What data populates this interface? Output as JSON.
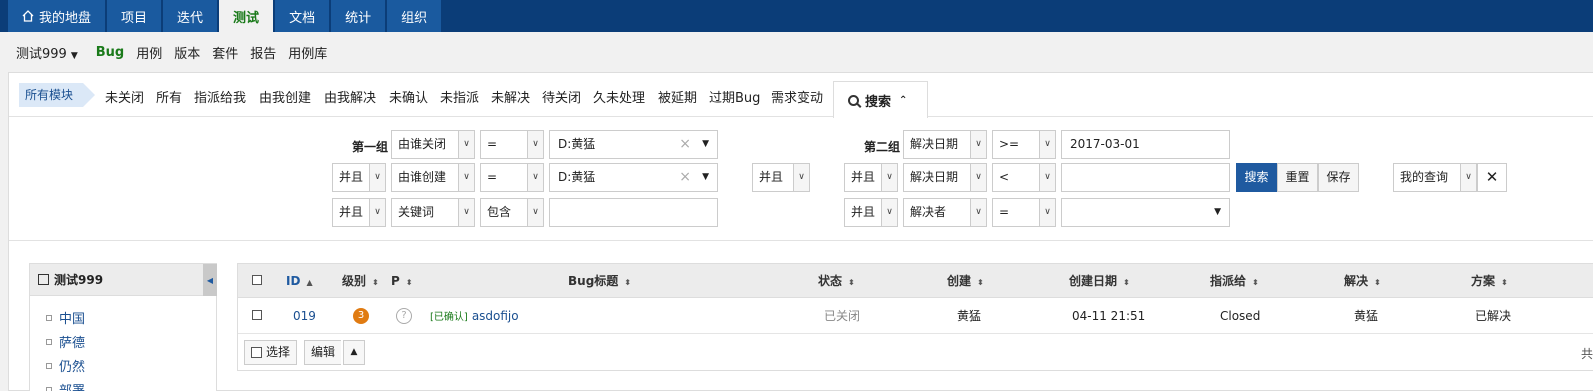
{
  "topnav": {
    "tabs": [
      {
        "label": "我的地盘",
        "icon": "home-icon"
      },
      {
        "label": "项目"
      },
      {
        "label": "迭代"
      },
      {
        "label": "测试",
        "active": true
      },
      {
        "label": "文档"
      },
      {
        "label": "统计"
      },
      {
        "label": "组织"
      }
    ]
  },
  "subnav": {
    "product": "测试999",
    "items": [
      "Bug",
      "用例",
      "版本",
      "套件",
      "报告",
      "用例库"
    ]
  },
  "featurebar": {
    "all_modules": "所有模块",
    "tabs": [
      "未关闭",
      "所有",
      "指派给我",
      "由我创建",
      "由我解决",
      "未确认",
      "未指派",
      "未解决",
      "待关闭",
      "久未处理",
      "被延期",
      "过期Bug",
      "需求变动"
    ],
    "search_label": "搜索"
  },
  "search": {
    "group1_label": "第一组",
    "group2_label": "第二组",
    "group1": {
      "row1": {
        "field": "由谁关闭",
        "op": "=",
        "value": "D:黄猛"
      },
      "row2": {
        "and": "并且",
        "field": "由谁创建",
        "op": "=",
        "value": "D:黄猛"
      },
      "row3": {
        "and": "并且",
        "field": "关键词",
        "op": "包含",
        "value": ""
      }
    },
    "group_join": "并且",
    "group2": {
      "row1": {
        "field": "解决日期",
        "op": ">=",
        "value": "2017-03-01"
      },
      "row2": {
        "and": "并且",
        "field": "解决日期",
        "op": "<",
        "value": ""
      },
      "row3": {
        "and": "并且",
        "field": "解决者",
        "op": "=",
        "value": ""
      }
    },
    "buttons": {
      "search": "搜索",
      "reset": "重置",
      "save": "保存"
    },
    "my_query": "我的查询"
  },
  "sidebar": {
    "title": "测试999",
    "modules": [
      "中国",
      "萨德",
      "仍然",
      "部署"
    ]
  },
  "table": {
    "columns": [
      "ID",
      "级别",
      "P",
      "Bug标题",
      "状态",
      "创建",
      "创建日期",
      "指派给",
      "解决",
      "方案"
    ],
    "rows": [
      {
        "id": "019",
        "severity": "3",
        "priority": "?",
        "confirmed_tag": "[已确认]",
        "title": "asdofijo",
        "status": "已关闭",
        "creator": "黄猛",
        "created_date": "04-11 21:51",
        "assigned_to": "Closed",
        "resolved_by": "黄猛",
        "resolution": "已解决"
      }
    ],
    "footer": {
      "select": "选择",
      "edit": "编辑",
      "total_prefix": "共"
    }
  },
  "colors": {
    "nav_bg": "#0b3d78",
    "nav_tab": "#1a5a9f",
    "active_green": "#1a7a1a",
    "primary": "#1f5aa0",
    "severity3": "#e07b12"
  }
}
